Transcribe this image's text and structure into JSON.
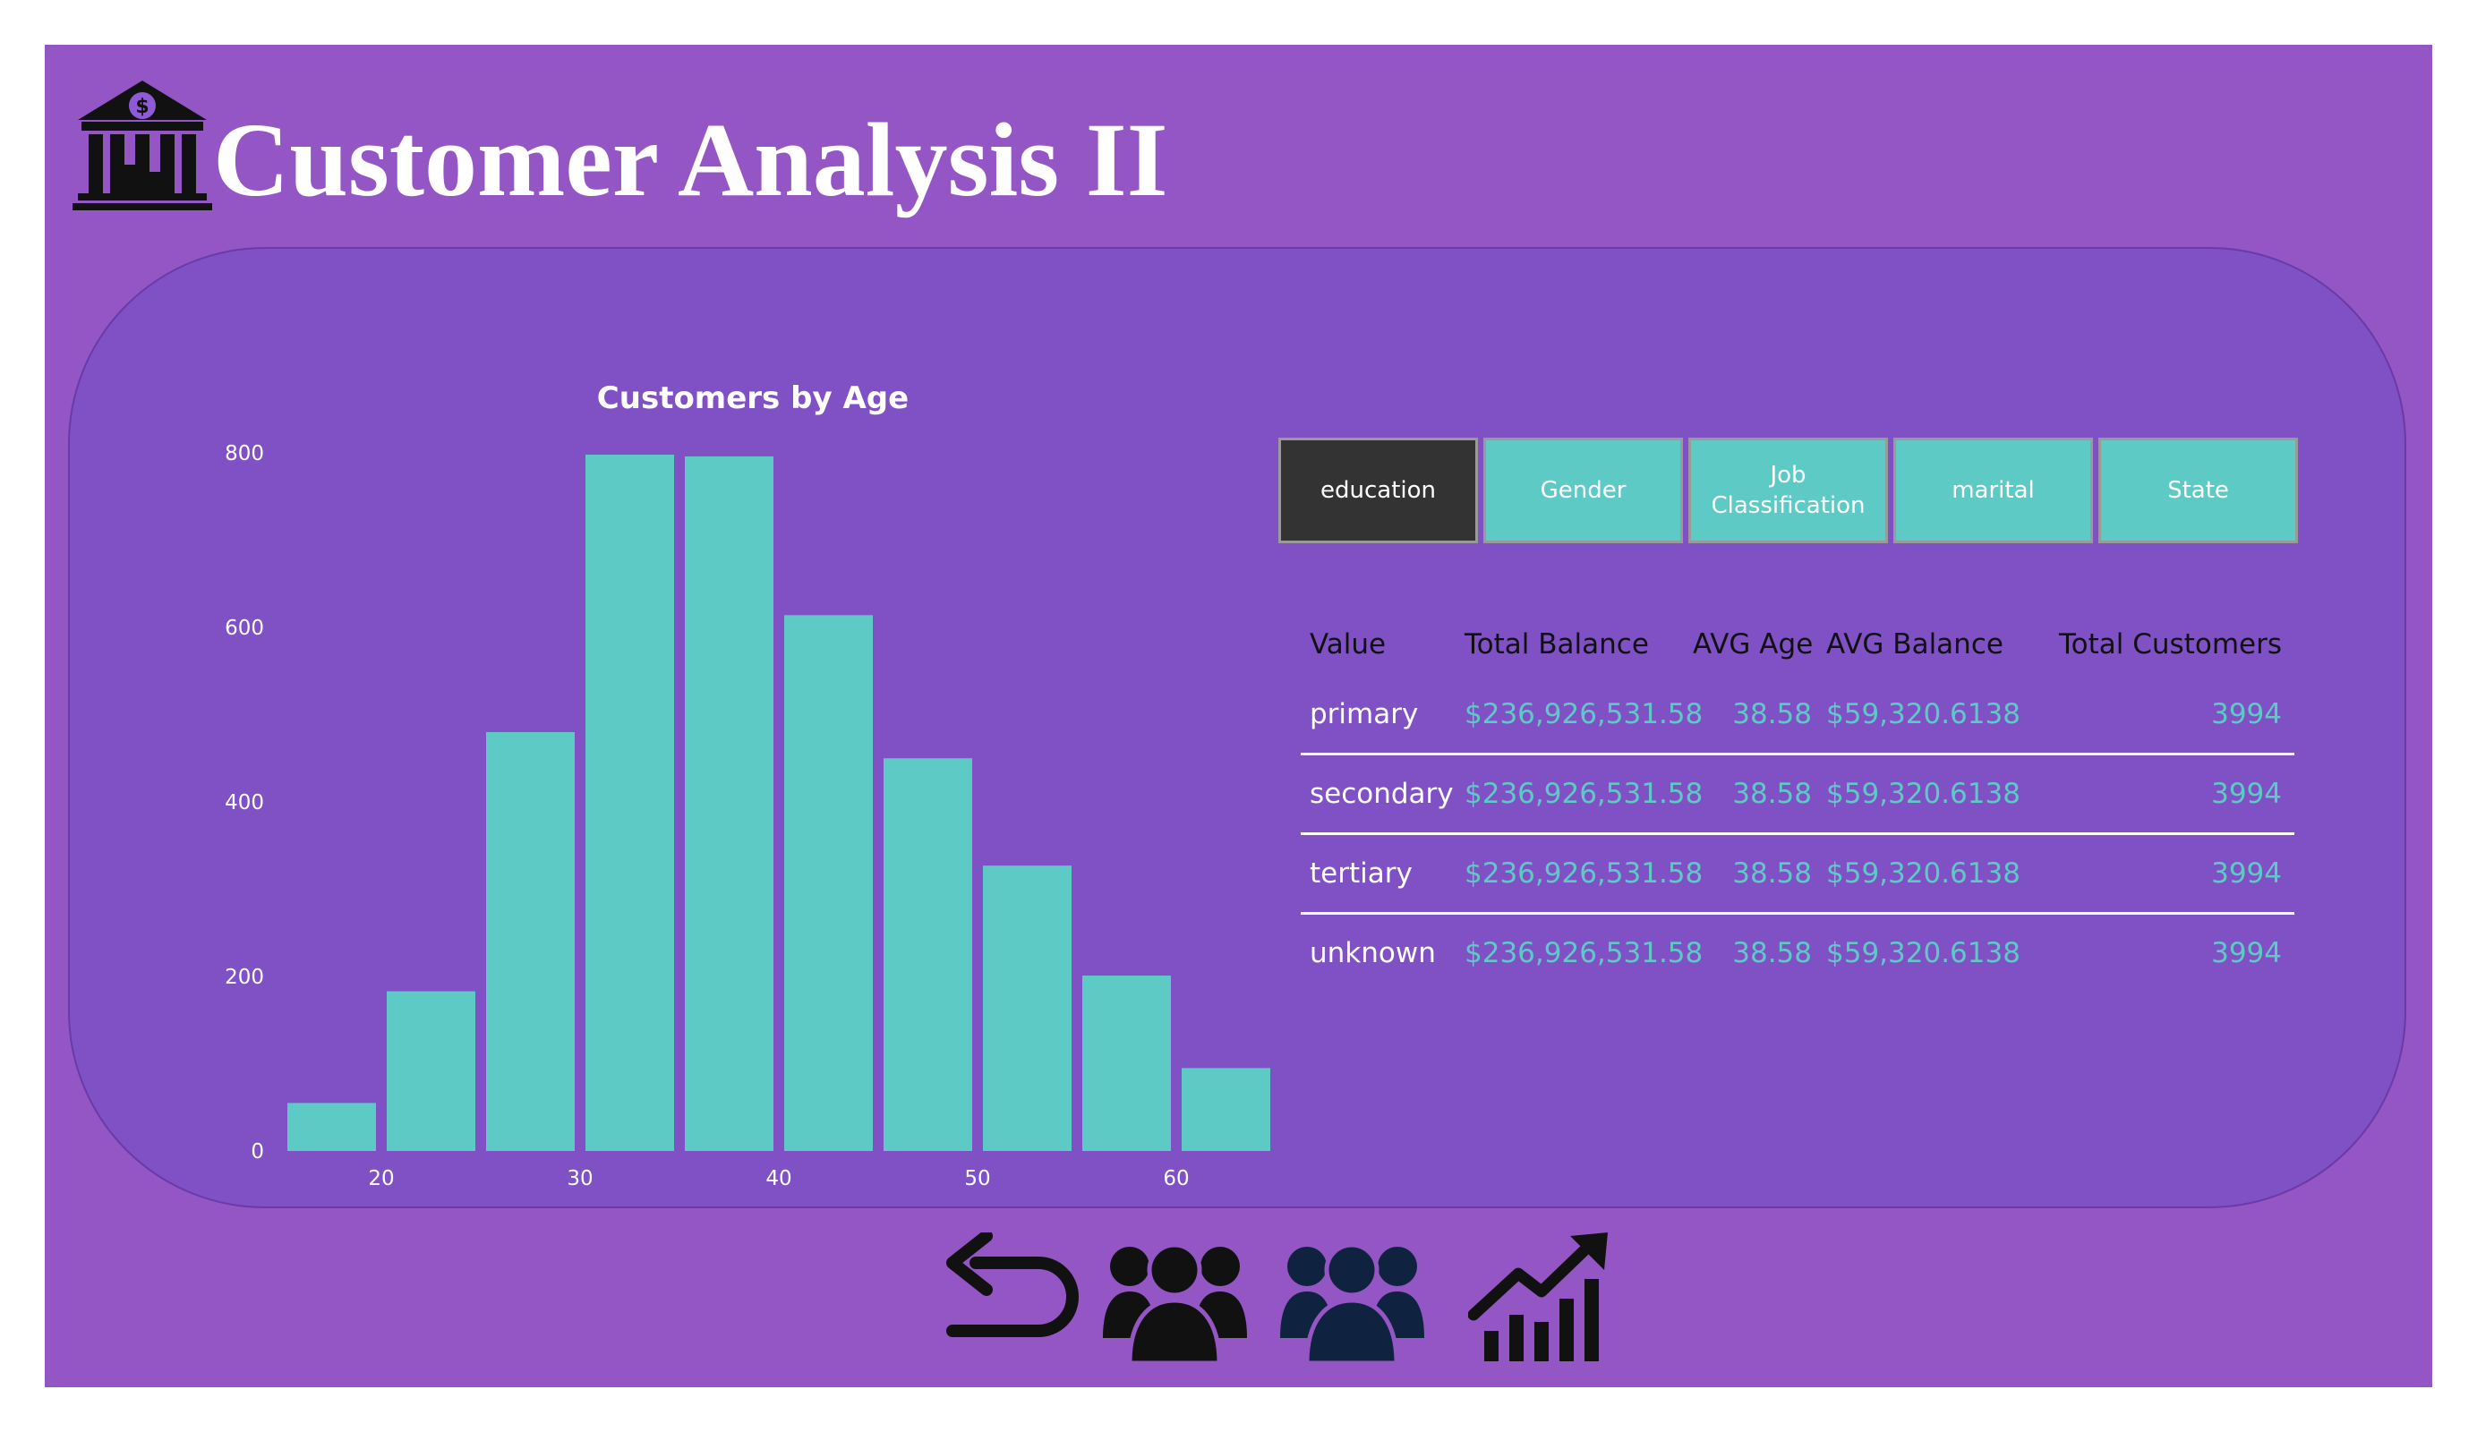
{
  "page": {
    "title": "Customer Analysis II",
    "logo_icon": "bank-icon"
  },
  "chart_data": {
    "type": "bar",
    "title": "Customers by Age",
    "xlabel": "",
    "ylabel": "",
    "bin_width": 5,
    "bins": [
      {
        "start": 15,
        "end": 20,
        "value": 55
      },
      {
        "start": 20,
        "end": 25,
        "value": 183
      },
      {
        "start": 25,
        "end": 30,
        "value": 480
      },
      {
        "start": 30,
        "end": 35,
        "value": 798
      },
      {
        "start": 35,
        "end": 40,
        "value": 796
      },
      {
        "start": 40,
        "end": 45,
        "value": 614
      },
      {
        "start": 45,
        "end": 50,
        "value": 450
      },
      {
        "start": 50,
        "end": 55,
        "value": 327
      },
      {
        "start": 55,
        "end": 60,
        "value": 201
      },
      {
        "start": 60,
        "end": 65,
        "value": 95
      }
    ],
    "xticks": [
      20,
      30,
      40,
      50,
      60
    ],
    "yticks": [
      0,
      200,
      400,
      600,
      800
    ],
    "ylim": [
      0,
      800
    ],
    "xlim": [
      15,
      65
    ],
    "bar_color": "#5ecac6",
    "grid": false
  },
  "tabs": [
    {
      "label": "education",
      "active": true
    },
    {
      "label": "Gender",
      "active": false
    },
    {
      "label": "Job Classification",
      "active": false
    },
    {
      "label": "marital",
      "active": false
    },
    {
      "label": "State",
      "active": false
    }
  ],
  "table": {
    "headers": [
      "Value",
      "Total Balance",
      "AVG Age",
      "AVG Balance",
      "Total Customers"
    ],
    "rows": [
      [
        "primary",
        "$236,926,531.58",
        "38.58",
        "$59,320.6138",
        "3994"
      ],
      [
        "secondary",
        "$236,926,531.58",
        "38.58",
        "$59,320.6138",
        "3994"
      ],
      [
        "tertiary",
        "$236,926,531.58",
        "38.58",
        "$59,320.6138",
        "3994"
      ],
      [
        "unknown",
        "$236,926,531.58",
        "38.58",
        "$59,320.6138",
        "3994"
      ]
    ]
  },
  "nav": [
    {
      "name": "back-arrow-icon"
    },
    {
      "name": "customers-group-icon"
    },
    {
      "name": "customers-group-icon-selected"
    },
    {
      "name": "growth-chart-icon"
    }
  ],
  "colors": {
    "background": "#9456c4",
    "panel": "#8050c5",
    "accent": "#5ecac6",
    "active_tab": "#333333",
    "selected_nav": "#0f2340"
  }
}
